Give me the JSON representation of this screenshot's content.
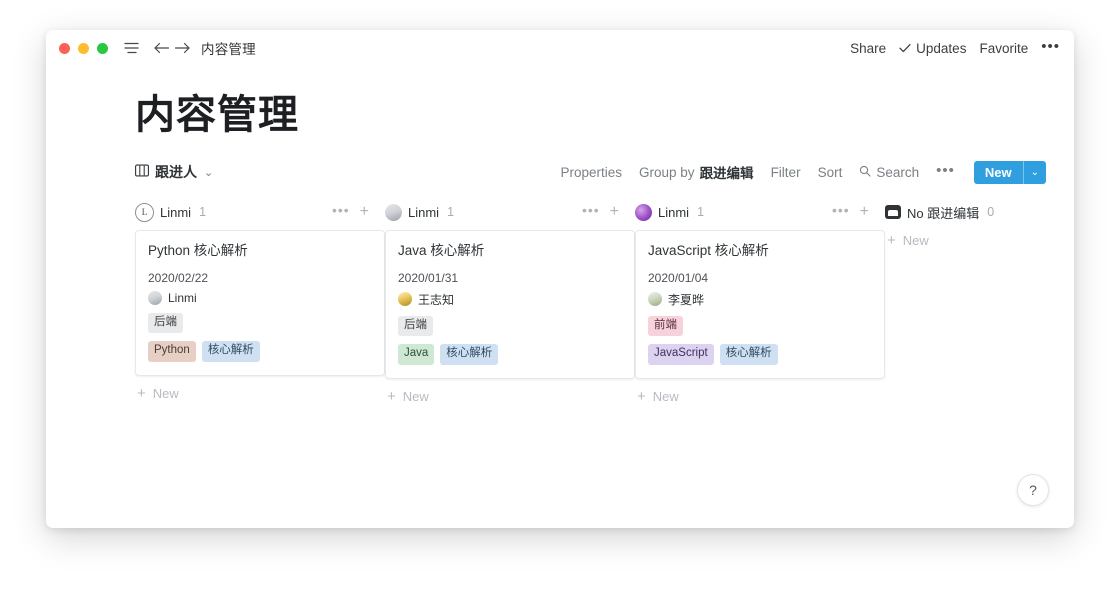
{
  "window": {
    "titlebar": {
      "traffic_lights": [
        "close",
        "minimize",
        "zoom"
      ],
      "menu_icon": "hamburger-icon",
      "back_icon": "arrow-left-icon",
      "forward_icon": "arrow-right-icon",
      "breadcrumb": "内容管理",
      "share_label": "Share",
      "updates_label": "Updates",
      "updates_check": "✓",
      "favorite_label": "Favorite",
      "more_label": "•••"
    }
  },
  "page": {
    "title": "内容管理",
    "view": {
      "icon": "board-view-icon",
      "label": "跟进人",
      "chevron": "⌄"
    },
    "toolbar": {
      "properties": "Properties",
      "group_by_prefix": "Group by",
      "group_by_value": "跟进编辑",
      "filter": "Filter",
      "sort": "Sort",
      "search": "Search",
      "more": "•••",
      "new_label": "New",
      "new_caret": "⌄",
      "accent_color": "#2f9fe0"
    }
  },
  "board": {
    "columns": [
      {
        "avatar_type": "ring",
        "avatar_initial": "L",
        "name": "Linmi",
        "count": "1",
        "more": "•••",
        "add": "+",
        "new_label": "New",
        "cards": [
          {
            "title": "Python 核心解析",
            "date": "2020/02/22",
            "person": "Linmi",
            "person_avatar": "photo-gray",
            "tags_row1": [
              {
                "label": "后端",
                "bg": "#e9eaeb",
                "fg": "#3b3f42"
              }
            ],
            "tags_row2": [
              {
                "label": "Python",
                "bg": "#e8cfc6",
                "fg": "#4a3b35"
              },
              {
                "label": "核心解析",
                "bg": "#cfe0f2",
                "fg": "#2f4a63"
              }
            ]
          }
        ]
      },
      {
        "avatar_type": "photo-gray",
        "avatar_initial": "",
        "name": "Linmi",
        "count": "1",
        "more": "•••",
        "add": "+",
        "new_label": "New",
        "cards": [
          {
            "title": "Java 核心解析",
            "date": "2020/01/31",
            "person": "王志知",
            "person_avatar": "photo-wang",
            "tags_row1": [
              {
                "label": "后端",
                "bg": "#e9eaeb",
                "fg": "#3b3f42"
              }
            ],
            "tags_row2": [
              {
                "label": "Java",
                "bg": "#cfe8d4",
                "fg": "#2f4f38"
              },
              {
                "label": "核心解析",
                "bg": "#cfe0f2",
                "fg": "#2f4a63"
              }
            ]
          }
        ]
      },
      {
        "avatar_type": "photo-purple",
        "avatar_initial": "",
        "name": "Linmi",
        "count": "1",
        "more": "•••",
        "add": "+",
        "new_label": "New",
        "cards": [
          {
            "title": "JavaScript 核心解析",
            "date": "2020/01/04",
            "person": "李夏晔",
            "person_avatar": "photo-li",
            "tags_row1": [
              {
                "label": "前端",
                "bg": "#f6d3dc",
                "fg": "#5c2b39"
              }
            ],
            "tags_row2": [
              {
                "label": "JavaScript",
                "bg": "#ddd2f0",
                "fg": "#3e3163"
              },
              {
                "label": "核心解析",
                "bg": "#cfe0f2",
                "fg": "#2f4a63"
              }
            ]
          }
        ]
      },
      {
        "avatar_type": "no-value",
        "avatar_initial": "",
        "name": "No 跟进编辑",
        "count": "0",
        "more": "",
        "add": "",
        "new_label": "New",
        "cards": []
      }
    ]
  },
  "help": {
    "label": "?"
  }
}
